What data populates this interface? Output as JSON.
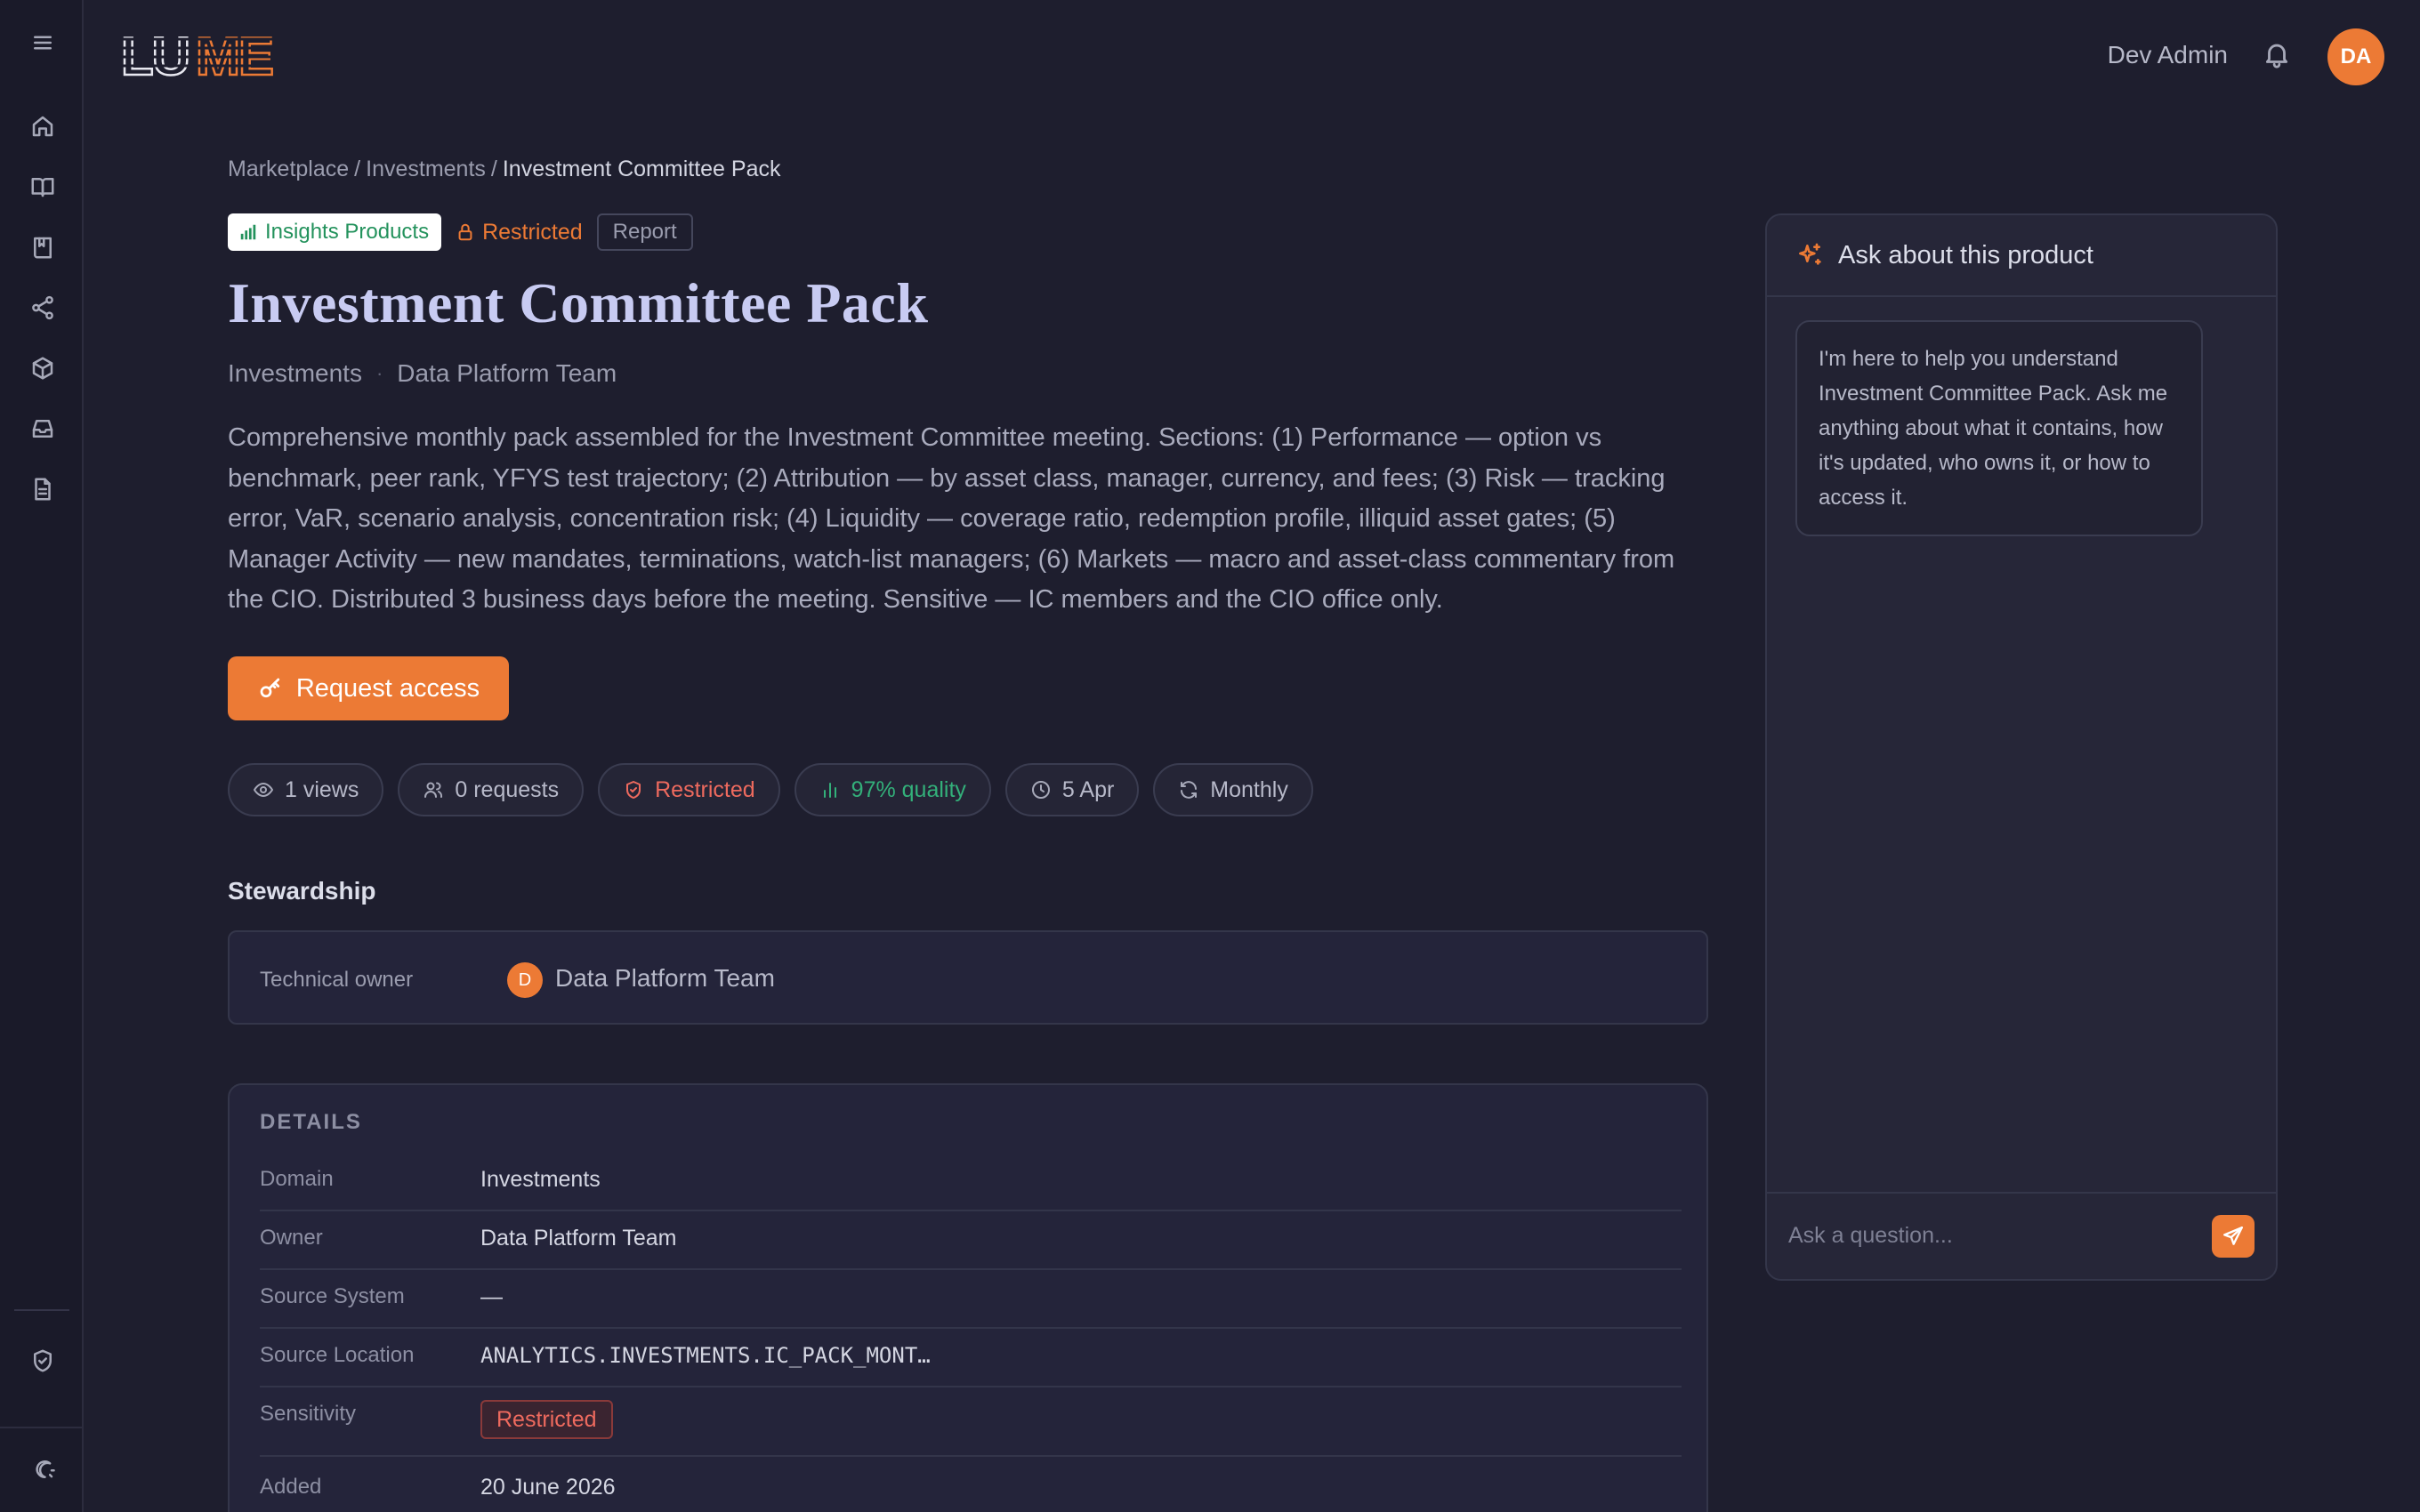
{
  "topbar": {
    "brand": "LUME",
    "user_name": "Dev Admin",
    "avatar_initials": "DA"
  },
  "sidebar": {
    "items": [
      {
        "icon": "menu-icon"
      },
      {
        "icon": "home-icon"
      },
      {
        "icon": "book-open-icon"
      },
      {
        "icon": "book-bookmark-icon"
      },
      {
        "icon": "share-icon"
      },
      {
        "icon": "package-icon"
      },
      {
        "icon": "inbox-icon"
      },
      {
        "icon": "document-icon"
      },
      {
        "icon": "shield-check-icon"
      },
      {
        "icon": "theme-toggle-icon"
      }
    ]
  },
  "breadcrumb": {
    "items": [
      "Marketplace",
      "Investments",
      "Investment Committee Pack"
    ],
    "separator": "/"
  },
  "tags": {
    "category": "Insights Products",
    "access": "Restricted",
    "type": "Report"
  },
  "product": {
    "title": "Investment Committee Pack",
    "domain": "Investments",
    "team": "Data Platform Team",
    "description": "Comprehensive monthly pack assembled for the Investment Committee meeting. Sections: (1) Performance — option vs benchmark, peer rank, YFYS test trajectory; (2) Attribution — by asset class, manager, currency, and fees; (3) Risk — tracking error, VaR, scenario analysis, concentration risk; (4) Liquidity — coverage ratio, redemption profile, illiquid asset gates; (5) Manager Activity — new mandates, terminations, watch-list managers; (6) Markets — macro and asset-class commentary from the CIO. Distributed 3 business days before the meeting. Sensitive — IC members and the CIO office only."
  },
  "actions": {
    "request_access": "Request access"
  },
  "stats": {
    "views": "1 views",
    "requests": "0 requests",
    "access": "Restricted",
    "quality": "97% quality",
    "updated": "5 Apr",
    "frequency": "Monthly"
  },
  "stewardship": {
    "heading": "Stewardship",
    "label": "Technical owner",
    "owner_initial": "D",
    "owner_name": "Data Platform Team"
  },
  "details": {
    "heading": "DETAILS",
    "rows": [
      {
        "key": "Domain",
        "value": "Investments"
      },
      {
        "key": "Owner",
        "value": "Data Platform Team"
      },
      {
        "key": "Source System",
        "value": "—"
      },
      {
        "key": "Source Location",
        "value": "ANALYTICS.INVESTMENTS.IC_PACK_MONT…"
      },
      {
        "key": "Sensitivity",
        "value": "Restricted"
      },
      {
        "key": "Added",
        "value": "20 June 2026"
      }
    ]
  },
  "chat": {
    "title": "Ask about this product",
    "greeting": "I'm here to help you understand Investment Committee Pack. Ask me anything about what it contains, how it's updated, who owns it, or how to access it.",
    "input_placeholder": "Ask a question..."
  },
  "colors": {
    "accent": "#ec7a35",
    "background": "#1e1e2e",
    "restricted": "#ee6a5e",
    "quality": "#33b07a"
  }
}
